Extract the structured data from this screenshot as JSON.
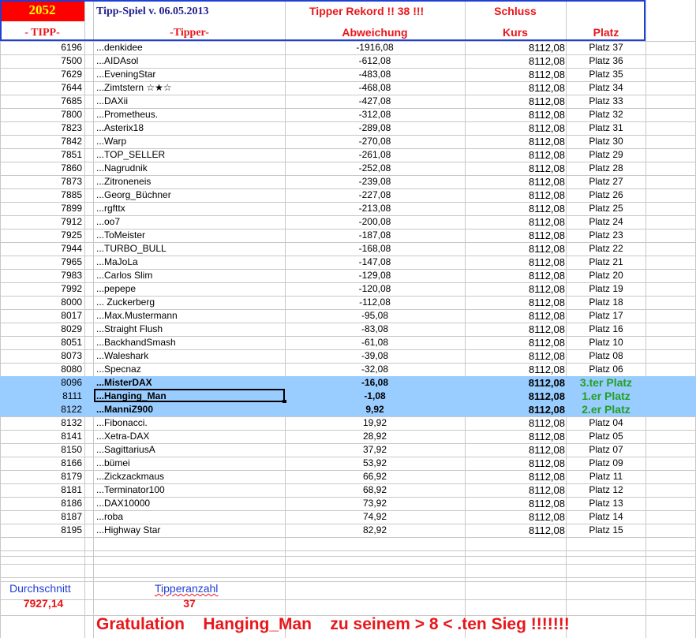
{
  "header": {
    "count": "2052",
    "title": "Tipp-Spiel v. 06.05.2013",
    "record": "Tipper Rekord !!  38  !!!",
    "schluss": "Schluss",
    "col_tipp": "- TIPP-",
    "col_tipper": "-Tipper-",
    "col_abw": "Abweichung",
    "col_kurs": "Kurs",
    "col_platz": "Platz"
  },
  "rows": [
    {
      "tipp": "6196",
      "name": "...denkidee",
      "abw": "-1916,08",
      "kurs": "8112,08",
      "platz": "Platz 37"
    },
    {
      "tipp": "7500",
      "name": "...AIDAsol",
      "abw": "-612,08",
      "kurs": "8112,08",
      "platz": "Platz 36"
    },
    {
      "tipp": "7629",
      "name": "...EveningStar",
      "abw": "-483,08",
      "kurs": "8112,08",
      "platz": "Platz 35"
    },
    {
      "tipp": "7644",
      "name": "...Zimtstern ☆★☆",
      "abw": "-468,08",
      "kurs": "8112,08",
      "platz": "Platz 34"
    },
    {
      "tipp": "7685",
      "name": "...DAXii",
      "abw": "-427,08",
      "kurs": "8112,08",
      "platz": "Platz 33"
    },
    {
      "tipp": "7800",
      "name": "...Prometheus.",
      "abw": "-312,08",
      "kurs": "8112,08",
      "platz": "Platz 32"
    },
    {
      "tipp": "7823",
      "name": "...Asterix18",
      "abw": "-289,08",
      "kurs": "8112,08",
      "platz": "Platz 31"
    },
    {
      "tipp": "7842",
      "name": "...Warp",
      "abw": "-270,08",
      "kurs": "8112,08",
      "platz": "Platz 30"
    },
    {
      "tipp": "7851",
      "name": "...TOP_SELLER",
      "abw": "-261,08",
      "kurs": "8112,08",
      "platz": "Platz 29"
    },
    {
      "tipp": "7860",
      "name": "...Nagrudnik",
      "abw": "-252,08",
      "kurs": "8112,08",
      "platz": "Platz 28"
    },
    {
      "tipp": "7873",
      "name": "...Zitroneneis",
      "abw": "-239,08",
      "kurs": "8112,08",
      "platz": "Platz 27"
    },
    {
      "tipp": "7885",
      "name": "...Georg_Büchner",
      "abw": "-227,08",
      "kurs": "8112,08",
      "platz": "Platz 26"
    },
    {
      "tipp": "7899",
      "name": "...rgfttx",
      "abw": "-213,08",
      "kurs": "8112,08",
      "platz": "Platz 25"
    },
    {
      "tipp": "7912",
      "name": "...oo7",
      "abw": "-200,08",
      "kurs": "8112,08",
      "platz": "Platz 24"
    },
    {
      "tipp": "7925",
      "name": "...ToMeister",
      "abw": "-187,08",
      "kurs": "8112,08",
      "platz": "Platz 23"
    },
    {
      "tipp": "7944",
      "name": "...TURBO_BULL",
      "abw": "-168,08",
      "kurs": "8112,08",
      "platz": "Platz 22"
    },
    {
      "tipp": "7965",
      "name": "...MaJoLa",
      "abw": "-147,08",
      "kurs": "8112,08",
      "platz": "Platz 21"
    },
    {
      "tipp": "7983",
      "name": "...Carlos Slim",
      "abw": "-129,08",
      "kurs": "8112,08",
      "platz": "Platz 20"
    },
    {
      "tipp": "7992",
      "name": "...pepepe",
      "abw": "-120,08",
      "kurs": "8112,08",
      "platz": "Platz 19"
    },
    {
      "tipp": "8000",
      "name": "... Zuckerberg",
      "abw": "-112,08",
      "kurs": "8112,08",
      "platz": "Platz 18"
    },
    {
      "tipp": "8017",
      "name": "...Max.Mustermann",
      "abw": "-95,08",
      "kurs": "8112,08",
      "platz": "Platz 17"
    },
    {
      "tipp": "8029",
      "name": "...Straight Flush",
      "abw": "-83,08",
      "kurs": "8112,08",
      "platz": "Platz 16"
    },
    {
      "tipp": "8051",
      "name": "...BackhandSmash",
      "abw": "-61,08",
      "kurs": "8112,08",
      "platz": "Platz 10"
    },
    {
      "tipp": "8073",
      "name": "...Waleshark",
      "abw": "-39,08",
      "kurs": "8112,08",
      "platz": "Platz 08"
    },
    {
      "tipp": "8080",
      "name": "...Specnaz",
      "abw": "-32,08",
      "kurs": "8112,08",
      "platz": "Platz 06"
    },
    {
      "tipp": "8096",
      "name": "...MisterDAX",
      "abw": "-16,08",
      "kurs": "8112,08",
      "platz": "3.ter Platz",
      "hl": true
    },
    {
      "tipp": "8111",
      "name": "...Hanging_Man",
      "abw": "-1,08",
      "kurs": "8112,08",
      "platz": "1.er Platz",
      "hl": true,
      "selected": true
    },
    {
      "tipp": "8122",
      "name": "...ManniZ900",
      "abw": "9,92",
      "kurs": "8112,08",
      "platz": "2.er Platz",
      "hl": true
    },
    {
      "tipp": "8132",
      "name": "...Fibonacci.",
      "abw": "19,92",
      "kurs": "8112,08",
      "platz": "Platz 04"
    },
    {
      "tipp": "8141",
      "name": "...Xetra-DAX",
      "abw": "28,92",
      "kurs": "8112,08",
      "platz": "Platz 05"
    },
    {
      "tipp": "8150",
      "name": "...SagittariusA",
      "abw": "37,92",
      "kurs": "8112,08",
      "platz": "Platz 07"
    },
    {
      "tipp": "8166",
      "name": "...bümei",
      "abw": "53,92",
      "kurs": "8112,08",
      "platz": "Platz 09"
    },
    {
      "tipp": "8179",
      "name": "...Zickzackmaus",
      "abw": "66,92",
      "kurs": "8112,08",
      "platz": "Platz 11"
    },
    {
      "tipp": "8181",
      "name": "...Terminator100",
      "abw": "68,92",
      "kurs": "8112,08",
      "platz": "Platz 12"
    },
    {
      "tipp": "8186",
      "name": "...DAX10000",
      "abw": "73,92",
      "kurs": "8112,08",
      "platz": "Platz 13"
    },
    {
      "tipp": "8187",
      "name": "...roba",
      "abw": "74,92",
      "kurs": "8112,08",
      "platz": "Platz 14"
    },
    {
      "tipp": "8195",
      "name": "...Highway Star",
      "abw": "82,92",
      "kurs": "8112,08",
      "platz": "Platz 15"
    }
  ],
  "footer": {
    "avg_label": "Durchschnitt",
    "avg_value": "7927,14",
    "count_label": "Tipperanzahl",
    "count_value": "37",
    "congrats": "Gratulation    Hanging_Man    zu seinem > 8 < .ten Sieg !!!!!!!"
  },
  "colors": {
    "accent_blue": "#1f3fd6",
    "header_red": "#e8161a",
    "highlight": "#99ccff",
    "winner_green": "#21a121"
  }
}
